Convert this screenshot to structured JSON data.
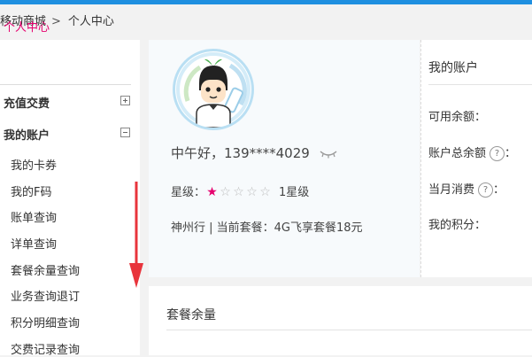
{
  "breadcrumb": {
    "root": "移动商城",
    "separator": ">",
    "current": "个人中心"
  },
  "sidebar": {
    "title": "个人中心",
    "groups": [
      {
        "label": "充值交费",
        "expanded": false
      },
      {
        "label": "我的账户",
        "expanded": true
      }
    ],
    "items": [
      "我的卡券",
      "我的F码",
      "账单查询",
      "详单查询",
      "套餐余量查询",
      "业务查询退订",
      "积分明细查询",
      "交费记录查询"
    ]
  },
  "user": {
    "greeting": "中午好，139****4029",
    "star_label": "星级：",
    "stars_total": 5,
    "stars_filled": 1,
    "level_text": "1星级",
    "plan_text": "神州行 | 当前套餐：4G飞享套餐18元"
  },
  "account": {
    "title": "我的账户",
    "rows": [
      {
        "label": "可用余额：",
        "help": false
      },
      {
        "label": "账户总余额",
        "help": true,
        "suffix": "："
      },
      {
        "label": "当月消费",
        "help": true,
        "suffix": "："
      },
      {
        "label": "我的积分：",
        "help": false
      }
    ],
    "help_glyph": "?"
  },
  "package": {
    "title": "套餐余量"
  },
  "colors": {
    "accent": "#e6006e",
    "topbar": "#1f8fe0",
    "arrow": "#e8343c"
  }
}
